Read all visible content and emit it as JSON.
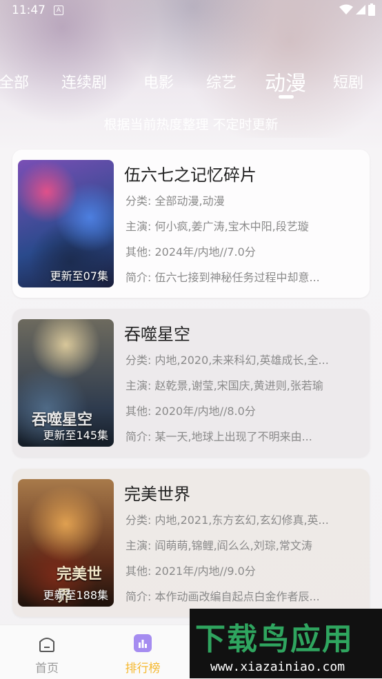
{
  "status_bar": {
    "time": "11:47",
    "badge": "A"
  },
  "tabs": [
    {
      "label": "全部"
    },
    {
      "label": "连续剧"
    },
    {
      "label": "电影"
    },
    {
      "label": "综艺"
    },
    {
      "label": "动漫",
      "active": true
    },
    {
      "label": "短剧"
    }
  ],
  "subtitle": "根据当前热度整理 不定时更新",
  "items": [
    {
      "title": "伍六七之记忆碎片",
      "episode": "更新至07集",
      "category": "分类: 全部动漫,动漫",
      "cast": "主演: 何小疯,姜广涛,宝木中阳,段艺璇",
      "other": "其他: 2024年/内地//7.0分",
      "summary": "简介: 伍六七接到神秘任务过程中却意..."
    },
    {
      "title": "吞噬星空",
      "episode": "更新至145集",
      "category": "分类: 内地,2020,未来科幻,英雄成长,全...",
      "cast": "主演: 赵乾景,谢莹,宋国庆,黄进则,张若瑜",
      "other": "其他: 2020年/内地//8.0分",
      "summary": "简介: 某一天,地球上出现了不明来由...",
      "poster_text": "吞噬星空"
    },
    {
      "title": "完美世界",
      "episode": "更新至188集",
      "category": "分类: 内地,2021,东方玄幻,玄幻修真,英...",
      "cast": "主演: 阎萌萌,锦鲤,阎么么,刘琮,常文涛",
      "other": "其他: 2021年/内地//9.0分",
      "summary": "简介: 本作动画改编自起点白金作者辰...",
      "poster_text": "完美世界"
    }
  ],
  "bottom_nav": [
    {
      "label": "首页",
      "icon": "home-icon"
    },
    {
      "label": "排行榜",
      "icon": "ranking-icon",
      "active": true
    }
  ],
  "watermark": {
    "logo": "下载鸟应用",
    "url": "www.xiazainiao.com"
  },
  "colors": {
    "accent": "#f5b82e",
    "nav_active_icon": "#a58cf0",
    "watermark_green": "#2fa55f"
  }
}
